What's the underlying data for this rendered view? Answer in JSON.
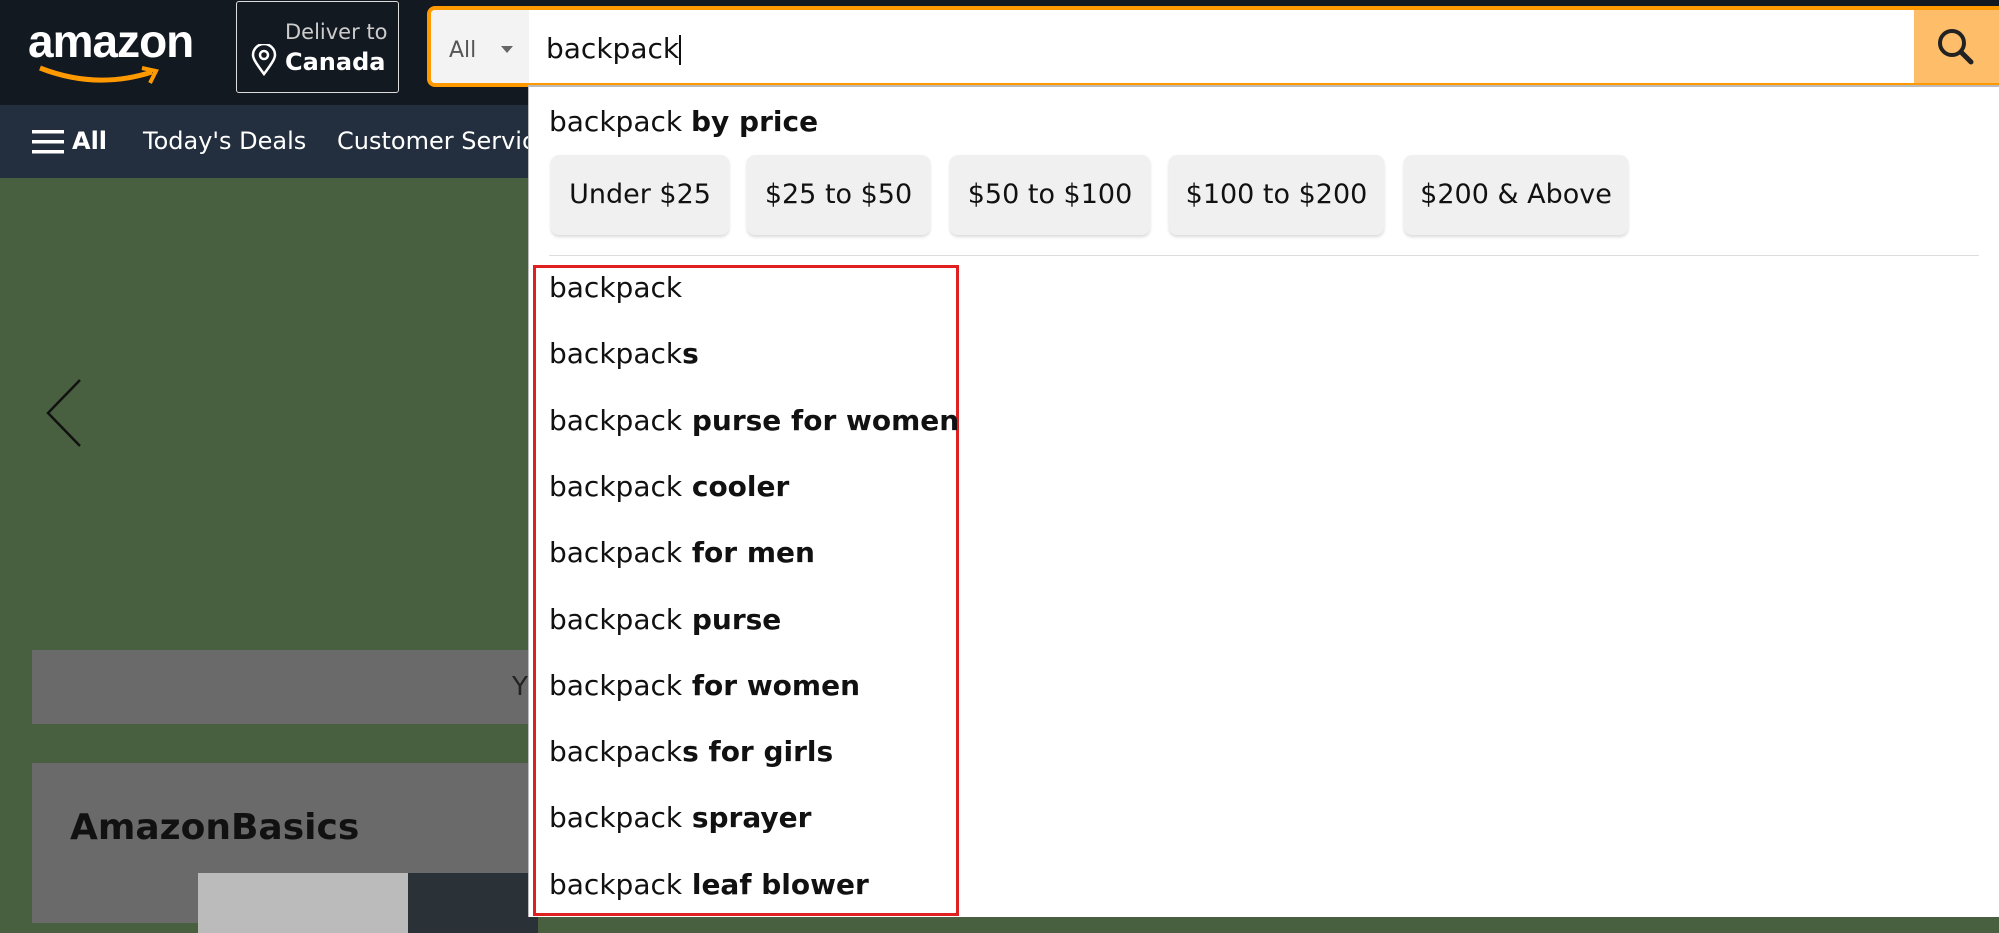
{
  "header": {
    "logo": "amazon",
    "deliver_label": "Deliver to",
    "deliver_location": "Canada",
    "search_category": "All",
    "search_query": "backpack",
    "search_icon": "magnifier"
  },
  "nav": {
    "all": "All",
    "items": [
      "Today's Deals",
      "Customer Servic"
    ]
  },
  "background": {
    "band_text": "Y",
    "card_title": "AmazonBasics"
  },
  "dropdown": {
    "price_prefix": "backpack",
    "price_suffix": "by price",
    "price_chips": [
      "Under $25",
      "$25 to $50",
      "$50 to $100",
      "$100 to $200",
      "$200 & Above"
    ],
    "suggestions": [
      {
        "base": "backpack",
        "bold": ""
      },
      {
        "base": "backpack",
        "bold": "s"
      },
      {
        "base": "backpack",
        "bold": " purse for women"
      },
      {
        "base": "backpack",
        "bold": " cooler"
      },
      {
        "base": "backpack",
        "bold": " for men"
      },
      {
        "base": "backpack",
        "bold": " purse"
      },
      {
        "base": "backpack",
        "bold": " for women"
      },
      {
        "base": "backpack",
        "bold": "s for girls"
      },
      {
        "base": "backpack",
        "bold": " sprayer"
      },
      {
        "base": "backpack",
        "bold": " leaf blower"
      }
    ]
  },
  "colors": {
    "highlight_box": "#e02020",
    "search_border": "#ff9900",
    "search_button": "#febd69"
  }
}
